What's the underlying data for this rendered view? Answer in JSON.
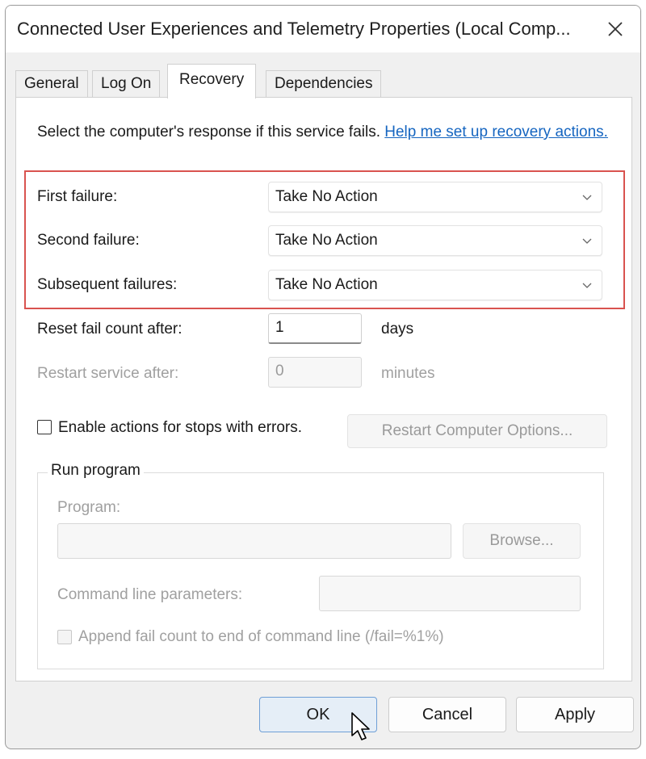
{
  "window": {
    "title": "Connected User Experiences and Telemetry Properties (Local Comp..."
  },
  "tabs": [
    {
      "label": "General",
      "active": false
    },
    {
      "label": "Log On",
      "active": false
    },
    {
      "label": "Recovery",
      "active": true
    },
    {
      "label": "Dependencies",
      "active": false
    }
  ],
  "recovery": {
    "intro_text": "Select the computer's response if this service fails. ",
    "help_link": "Help me set up recovery actions.",
    "first_failure": {
      "label": "First failure:",
      "value": "Take No Action"
    },
    "second_failure": {
      "label": "Second failure:",
      "value": "Take No Action"
    },
    "subsequent_failures": {
      "label": "Subsequent failures:",
      "value": "Take No Action"
    },
    "reset_fail_count": {
      "label": "Reset fail count after:",
      "value": "1",
      "unit": "days"
    },
    "restart_service": {
      "label": "Restart service after:",
      "value": "0",
      "unit": "minutes"
    },
    "enable_actions_checkbox": {
      "label": "Enable actions for stops with errors.",
      "checked": false
    },
    "restart_computer_button": "Restart Computer Options...",
    "run_program": {
      "group_title": "Run program",
      "program_label": "Program:",
      "program_value": "",
      "browse_button": "Browse...",
      "cmdline_label": "Command line parameters:",
      "cmdline_value": "",
      "append_checkbox": {
        "label": "Append fail count to end of command line (/fail=%1%)",
        "checked": false
      }
    }
  },
  "footer": {
    "ok": "OK",
    "cancel": "Cancel",
    "apply": "Apply"
  },
  "colors": {
    "highlight_border": "#d9534f",
    "link": "#1565c0",
    "ok_button_bg": "#e5eef7",
    "ok_button_border": "#6f9fd6"
  },
  "icons": {
    "close": "close-icon",
    "dropdown": "chevron-down-icon",
    "cursor": "mouse-pointer-icon"
  }
}
